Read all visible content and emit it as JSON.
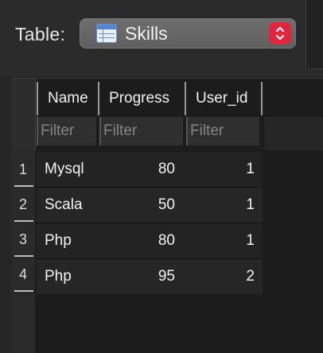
{
  "toolbar": {
    "table_label": "Table:",
    "selected_table": "Skills",
    "stepper_color": "#e0263e"
  },
  "grid": {
    "columns": [
      {
        "key": "name",
        "label": "Name"
      },
      {
        "key": "progress",
        "label": "Progress"
      },
      {
        "key": "user_id",
        "label": "User_id"
      }
    ],
    "filter_placeholder": "Filter",
    "rows": [
      {
        "num": "1",
        "name": "Mysql",
        "progress": "80",
        "user_id": "1"
      },
      {
        "num": "2",
        "name": "Scala",
        "progress": "50",
        "user_id": "1"
      },
      {
        "num": "3",
        "name": "Php",
        "progress": "80",
        "user_id": "1"
      },
      {
        "num": "4",
        "name": "Php",
        "progress": "95",
        "user_id": "2"
      }
    ]
  },
  "icons": {
    "table": "table-icon",
    "stepper": "up-down-stepper-icon"
  }
}
